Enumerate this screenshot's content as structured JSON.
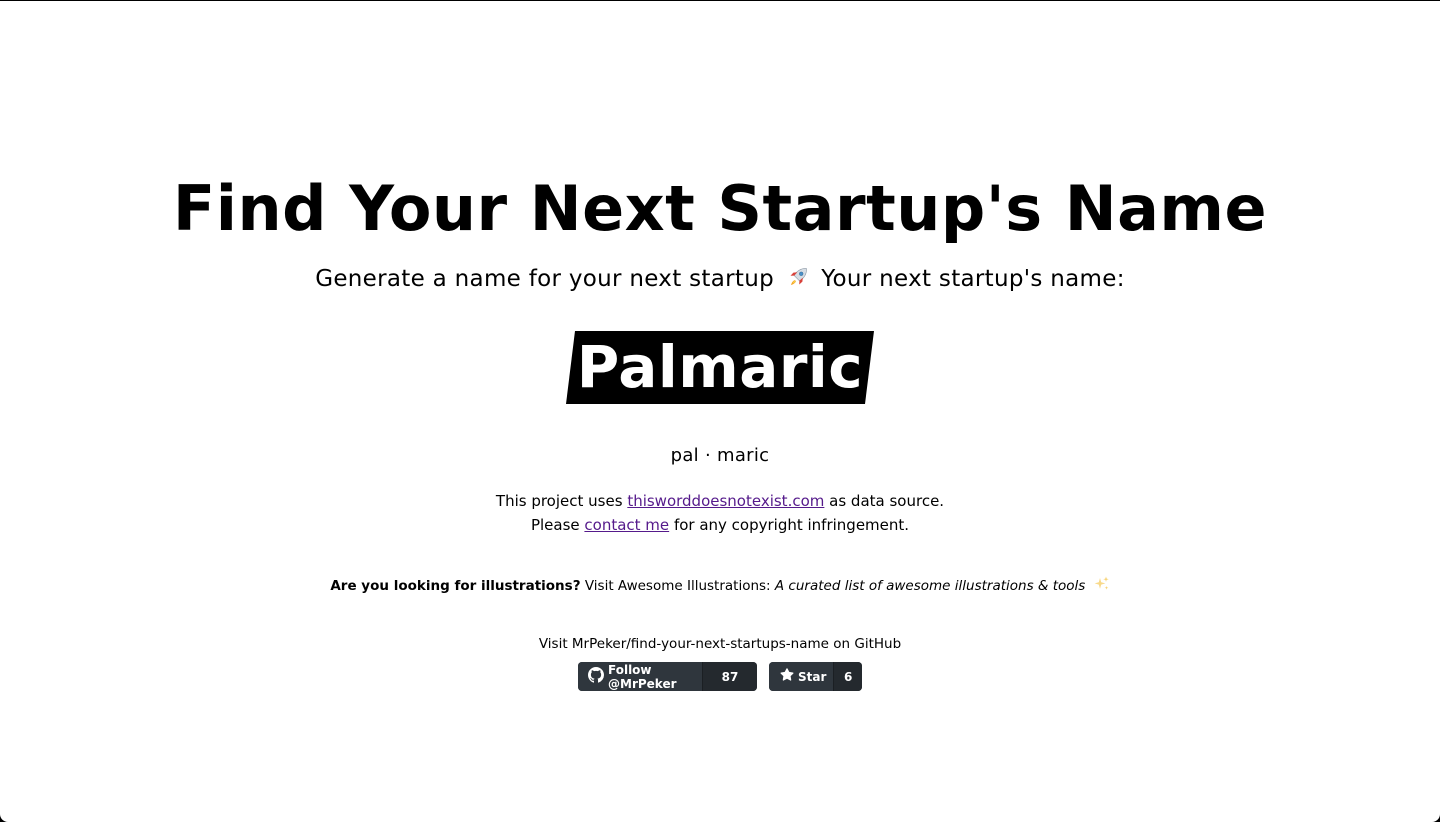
{
  "header": {
    "title": "Find Your Next Startup's Name",
    "subtitle_before_icon": "Generate a name for your next startup",
    "subtitle_icon": "rocket-icon",
    "subtitle_after_icon": "Your next startup's name:"
  },
  "result": {
    "name": "Palmaric",
    "syllables": "pal · maric"
  },
  "credits": {
    "line1_prefix": "This project uses",
    "line1_link": "thisworddoesnotexist.com",
    "line1_suffix": "as data source.",
    "line2_prefix": "Please",
    "line2_link": "contact me",
    "line2_suffix": "for any copyright infringement."
  },
  "promo": {
    "question": "Are you looking for illustrations?",
    "visit_text": "Visit Awesome Illustrations:",
    "description": "A curated list of awesome illustrations & tools",
    "icon": "sparkles-icon"
  },
  "github": {
    "visit_text": "Visit MrPeker/find-your-next-startups-name on GitHub",
    "follow_label": "Follow @MrPeker",
    "follow_count": "87",
    "star_label": "Star",
    "star_count": "6"
  },
  "colors": {
    "background": "#ffffff",
    "text": "#000000",
    "name_highlight": "#000000",
    "link_visited": "#551a8b",
    "badge_bg": "#2f363d"
  }
}
